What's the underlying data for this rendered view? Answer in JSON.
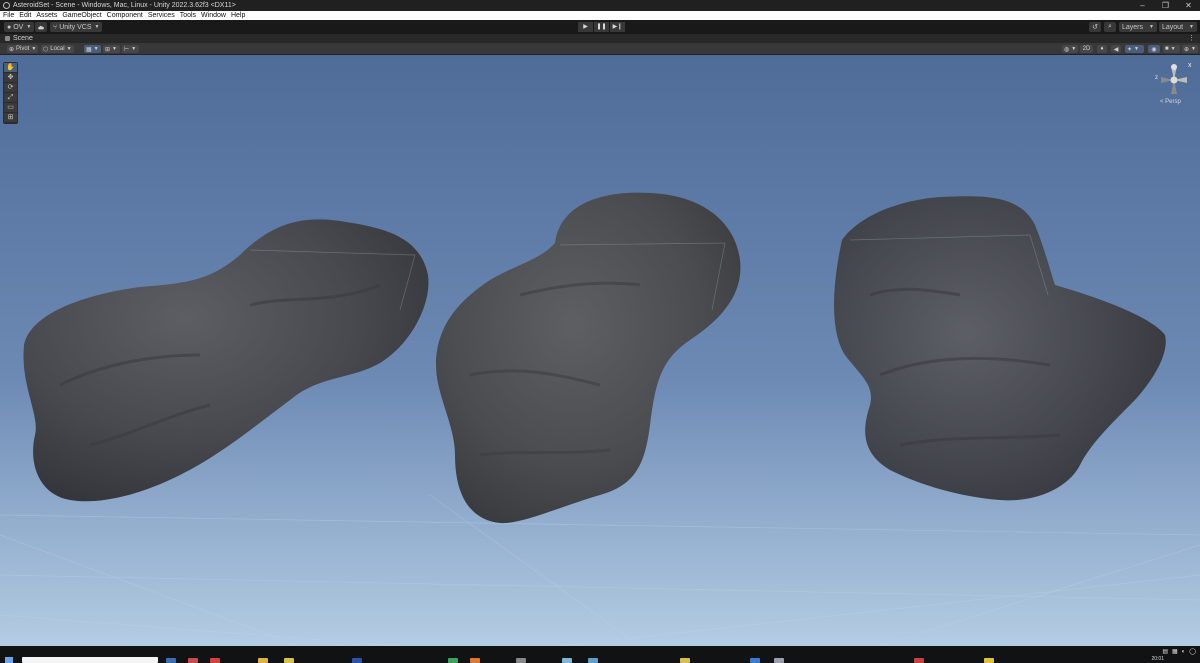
{
  "window": {
    "title": "AsteroidSet - Scene - Windows, Mac, Linux - Unity 2022.3.62f3 <DX11>",
    "minimize": "–",
    "maximize": "❐",
    "close": "✕"
  },
  "menu": [
    "File",
    "Edit",
    "Assets",
    "GameObject",
    "Component",
    "Services",
    "Tools",
    "Window",
    "Help"
  ],
  "toolbar": {
    "account_label": "OV",
    "cloud_icon": "cloud-icon",
    "vcs_label": "Unity VCS",
    "play_icon": "▶",
    "pause_icon": "❚❚",
    "step_icon": "▶❙",
    "history_icon": "↺",
    "search_icon": "⌕",
    "layers_label": "Layers",
    "layout_label": "Layout"
  },
  "scene_tab": {
    "label": "Scene",
    "menu_icon": "⋮"
  },
  "scene_toolbar": {
    "pivot_label": "Pivot",
    "local_label": "Local",
    "two_d_label": "2D"
  },
  "tools": [
    "✋",
    "✥",
    "⟳",
    "⤢",
    "▭",
    "⊞"
  ],
  "gizmo": {
    "projection_label": "< Persp",
    "x_label": "x",
    "z_label": "z"
  },
  "taskbar": {
    "clock": "20:01"
  },
  "colors": {
    "sky_top": "#4f6b98",
    "sky_bottom": "#b4cde3",
    "rock": "#4a4c52",
    "accent": "#46607f"
  }
}
